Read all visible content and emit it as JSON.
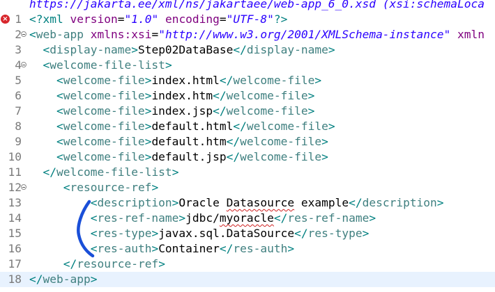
{
  "editor": {
    "lines": [
      {
        "num": "",
        "segs": [
          {
            "t": "https://jakarta.ee/xml/ns/jakartaee/web-app_6_0.xsd (xsi:schemaLoca",
            "c": "schema"
          }
        ]
      },
      {
        "num": "1",
        "error": true,
        "segs": [
          {
            "t": "<?",
            "c": "pi"
          },
          {
            "t": "xml",
            "c": "pi"
          },
          {
            "t": " version",
            "c": "an"
          },
          {
            "t": "=",
            "c": "tx"
          },
          {
            "t": "\"1.0\"",
            "c": "av"
          },
          {
            "t": " encoding",
            "c": "an"
          },
          {
            "t": "=",
            "c": "tx"
          },
          {
            "t": "\"UTF-8\"",
            "c": "av"
          },
          {
            "t": "?>",
            "c": "pi"
          }
        ]
      },
      {
        "num": "2",
        "fold": true,
        "segs": [
          {
            "t": "<",
            "c": "tb"
          },
          {
            "t": "web-app",
            "c": "t"
          },
          {
            "t": " xmlns:xsi",
            "c": "an"
          },
          {
            "t": "=",
            "c": "tx"
          },
          {
            "t": "\"http://www.w3.org/2001/XMLSchema-instance\"",
            "c": "av"
          },
          {
            "t": " xmln",
            "c": "an"
          }
        ]
      },
      {
        "num": "3",
        "segs": [
          {
            "t": "  ",
            "c": "tx"
          },
          {
            "t": "<",
            "c": "tb"
          },
          {
            "t": "display-name",
            "c": "t"
          },
          {
            "t": ">",
            "c": "tb"
          },
          {
            "t": "Step02DataBase",
            "c": "tx"
          },
          {
            "t": "</",
            "c": "tb"
          },
          {
            "t": "display-name",
            "c": "t"
          },
          {
            "t": ">",
            "c": "tb"
          }
        ]
      },
      {
        "num": "4",
        "fold": true,
        "segs": [
          {
            "t": "  ",
            "c": "tx"
          },
          {
            "t": "<",
            "c": "tb"
          },
          {
            "t": "welcome-file-list",
            "c": "t"
          },
          {
            "t": ">",
            "c": "tb"
          }
        ]
      },
      {
        "num": "5",
        "segs": [
          {
            "t": "    ",
            "c": "tx"
          },
          {
            "t": "<",
            "c": "tb"
          },
          {
            "t": "welcome-file",
            "c": "t"
          },
          {
            "t": ">",
            "c": "tb"
          },
          {
            "t": "index.html",
            "c": "tx"
          },
          {
            "t": "</",
            "c": "tb"
          },
          {
            "t": "welcome-file",
            "c": "t"
          },
          {
            "t": ">",
            "c": "tb"
          }
        ]
      },
      {
        "num": "6",
        "segs": [
          {
            "t": "    ",
            "c": "tx"
          },
          {
            "t": "<",
            "c": "tb"
          },
          {
            "t": "welcome-file",
            "c": "t"
          },
          {
            "t": ">",
            "c": "tb"
          },
          {
            "t": "index.htm",
            "c": "tx"
          },
          {
            "t": "</",
            "c": "tb"
          },
          {
            "t": "welcome-file",
            "c": "t"
          },
          {
            "t": ">",
            "c": "tb"
          }
        ]
      },
      {
        "num": "7",
        "segs": [
          {
            "t": "    ",
            "c": "tx"
          },
          {
            "t": "<",
            "c": "tb"
          },
          {
            "t": "welcome-file",
            "c": "t"
          },
          {
            "t": ">",
            "c": "tb"
          },
          {
            "t": "index.jsp",
            "c": "tx"
          },
          {
            "t": "</",
            "c": "tb"
          },
          {
            "t": "welcome-file",
            "c": "t"
          },
          {
            "t": ">",
            "c": "tb"
          }
        ]
      },
      {
        "num": "8",
        "segs": [
          {
            "t": "    ",
            "c": "tx"
          },
          {
            "t": "<",
            "c": "tb"
          },
          {
            "t": "welcome-file",
            "c": "t"
          },
          {
            "t": ">",
            "c": "tb"
          },
          {
            "t": "default.html",
            "c": "tx"
          },
          {
            "t": "</",
            "c": "tb"
          },
          {
            "t": "welcome-file",
            "c": "t"
          },
          {
            "t": ">",
            "c": "tb"
          }
        ]
      },
      {
        "num": "9",
        "segs": [
          {
            "t": "    ",
            "c": "tx"
          },
          {
            "t": "<",
            "c": "tb"
          },
          {
            "t": "welcome-file",
            "c": "t"
          },
          {
            "t": ">",
            "c": "tb"
          },
          {
            "t": "default.htm",
            "c": "tx"
          },
          {
            "t": "</",
            "c": "tb"
          },
          {
            "t": "welcome-file",
            "c": "t"
          },
          {
            "t": ">",
            "c": "tb"
          }
        ]
      },
      {
        "num": "10",
        "segs": [
          {
            "t": "    ",
            "c": "tx"
          },
          {
            "t": "<",
            "c": "tb"
          },
          {
            "t": "welcome-file",
            "c": "t"
          },
          {
            "t": ">",
            "c": "tb"
          },
          {
            "t": "default.jsp",
            "c": "tx"
          },
          {
            "t": "</",
            "c": "tb"
          },
          {
            "t": "welcome-file",
            "c": "t"
          },
          {
            "t": ">",
            "c": "tb"
          }
        ]
      },
      {
        "num": "11",
        "segs": [
          {
            "t": "  ",
            "c": "tx"
          },
          {
            "t": "</",
            "c": "tb"
          },
          {
            "t": "welcome-file-list",
            "c": "t"
          },
          {
            "t": ">",
            "c": "tb"
          }
        ]
      },
      {
        "num": "12",
        "fold": true,
        "segs": [
          {
            "t": "     ",
            "c": "tx"
          },
          {
            "t": "<",
            "c": "tb"
          },
          {
            "t": "resource-ref",
            "c": "t"
          },
          {
            "t": ">",
            "c": "tb"
          }
        ]
      },
      {
        "num": "13",
        "segs": [
          {
            "t": "         ",
            "c": "tx"
          },
          {
            "t": "<",
            "c": "tb"
          },
          {
            "t": "description",
            "c": "t"
          },
          {
            "t": ">",
            "c": "tb"
          },
          {
            "t": "Oracle ",
            "c": "tx"
          },
          {
            "t": "Datasource",
            "c": "tx",
            "spell": true
          },
          {
            "t": " example",
            "c": "tx"
          },
          {
            "t": "</",
            "c": "tb"
          },
          {
            "t": "description",
            "c": "t"
          },
          {
            "t": ">",
            "c": "tb"
          }
        ]
      },
      {
        "num": "14",
        "segs": [
          {
            "t": "         ",
            "c": "tx"
          },
          {
            "t": "<",
            "c": "tb"
          },
          {
            "t": "res-ref-name",
            "c": "t"
          },
          {
            "t": ">",
            "c": "tb"
          },
          {
            "t": "jdbc/",
            "c": "tx"
          },
          {
            "t": "myoracle",
            "c": "tx",
            "spell": true
          },
          {
            "t": "</",
            "c": "tb"
          },
          {
            "t": "res-ref-name",
            "c": "t"
          },
          {
            "t": ">",
            "c": "tb"
          }
        ]
      },
      {
        "num": "15",
        "segs": [
          {
            "t": "         ",
            "c": "tx"
          },
          {
            "t": "<",
            "c": "tb"
          },
          {
            "t": "res-type",
            "c": "t"
          },
          {
            "t": ">",
            "c": "tb"
          },
          {
            "t": "javax.sql.DataSource",
            "c": "tx"
          },
          {
            "t": "</",
            "c": "tb"
          },
          {
            "t": "res-type",
            "c": "t"
          },
          {
            "t": ">",
            "c": "tb"
          }
        ]
      },
      {
        "num": "16",
        "segs": [
          {
            "t": "         ",
            "c": "tx"
          },
          {
            "t": "<",
            "c": "tb"
          },
          {
            "t": "res-auth",
            "c": "t"
          },
          {
            "t": ">",
            "c": "tb"
          },
          {
            "t": "Container",
            "c": "tx"
          },
          {
            "t": "</",
            "c": "tb"
          },
          {
            "t": "res-auth",
            "c": "t"
          },
          {
            "t": ">",
            "c": "tb"
          }
        ]
      },
      {
        "num": "17",
        "segs": [
          {
            "t": "     ",
            "c": "tx"
          },
          {
            "t": "</",
            "c": "tb"
          },
          {
            "t": "resource-ref",
            "c": "t"
          },
          {
            "t": ">",
            "c": "tb"
          }
        ]
      },
      {
        "num": "18",
        "current": true,
        "segs": [
          {
            "t": "</",
            "c": "tb"
          },
          {
            "t": "web-app",
            "c": "t"
          },
          {
            "t": ">",
            "c": "tb"
          }
        ]
      }
    ]
  },
  "colors": {
    "background": "#ffffff",
    "current_line": "#e8f2fe",
    "annotation_stroke": "#1a4fd8"
  }
}
